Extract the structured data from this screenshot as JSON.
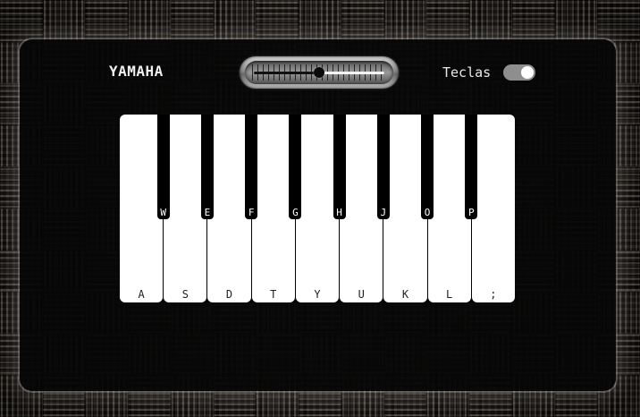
{
  "header": {
    "brand": "YAMAHA",
    "keys_label": "Teclas",
    "keys_toggle_on": true
  },
  "volume": {
    "level": 0.5
  },
  "piano": {
    "white_keys": [
      {
        "label": "A"
      },
      {
        "label": "S"
      },
      {
        "label": "D"
      },
      {
        "label": "T"
      },
      {
        "label": "Y"
      },
      {
        "label": "U"
      },
      {
        "label": "K"
      },
      {
        "label": "L"
      },
      {
        "label": ";"
      }
    ],
    "black_keys": [
      {
        "label": "W"
      },
      {
        "label": "E"
      },
      {
        "label": "F"
      },
      {
        "label": "G"
      },
      {
        "label": "H"
      },
      {
        "label": "J"
      },
      {
        "label": "O"
      },
      {
        "label": "P"
      }
    ]
  },
  "colors": {
    "white_key": "#ffffff",
    "black_key": "#000000",
    "toggle_track": "#8e8e8e",
    "brand_text": "#f0f0f0"
  }
}
